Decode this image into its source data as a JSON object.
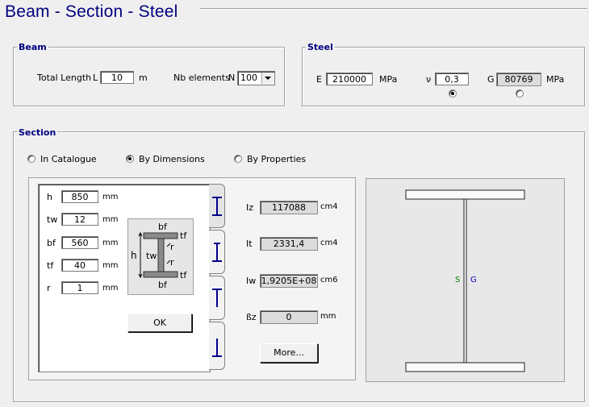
{
  "title": "Beam - Section - Steel",
  "beam": {
    "group_title": "Beam",
    "total_length_label": "Total Length",
    "length_symbol": "L",
    "length_value": "10",
    "length_unit": "m",
    "nb_elements_label": "Nb elements",
    "nb_symbol": "N",
    "nb_value": "100"
  },
  "steel": {
    "group_title": "Steel",
    "e_label": "E",
    "e_value": "210000",
    "e_unit": "MPa",
    "nu_label": "ν",
    "nu_value": "0,3",
    "g_label": "G",
    "g_value": "80769",
    "g_unit": "MPa"
  },
  "section": {
    "group_title": "Section",
    "options": [
      "In Catalogue",
      "By Dimensions",
      "By Properties"
    ],
    "selected": "By Dimensions",
    "dims": [
      {
        "label": "h",
        "value": "850",
        "unit": "mm"
      },
      {
        "label": "tw",
        "value": "12",
        "unit": "mm"
      },
      {
        "label": "bf",
        "value": "560",
        "unit": "mm"
      },
      {
        "label": "tf",
        "value": "40",
        "unit": "mm"
      },
      {
        "label": "r",
        "value": "1",
        "unit": "mm"
      }
    ],
    "diagram": {
      "bf_top": "bf",
      "bf_bottom": "bf",
      "tf_top": "tf",
      "tf_bottom": "tf",
      "h": "h",
      "tw": "tw",
      "r1": "r",
      "r2": "r"
    },
    "ok_label": "OK",
    "props": [
      {
        "label": "Iz",
        "value": "117088",
        "unit": "cm4"
      },
      {
        "label": "It",
        "value": "2331,4",
        "unit": "cm4"
      },
      {
        "label": "Iw",
        "value": "1,9205E+08",
        "unit": "cm6"
      },
      {
        "label": "ßz",
        "value": "0",
        "unit": "mm"
      }
    ],
    "more_label": "More...",
    "preview": {
      "s_label": "S",
      "g_label": "G",
      "s_color": "#008000",
      "g_color": "#0000c0"
    }
  },
  "colors": {
    "title": "#00007f",
    "group_title": "#000080",
    "tab_icon": "#00008b"
  }
}
